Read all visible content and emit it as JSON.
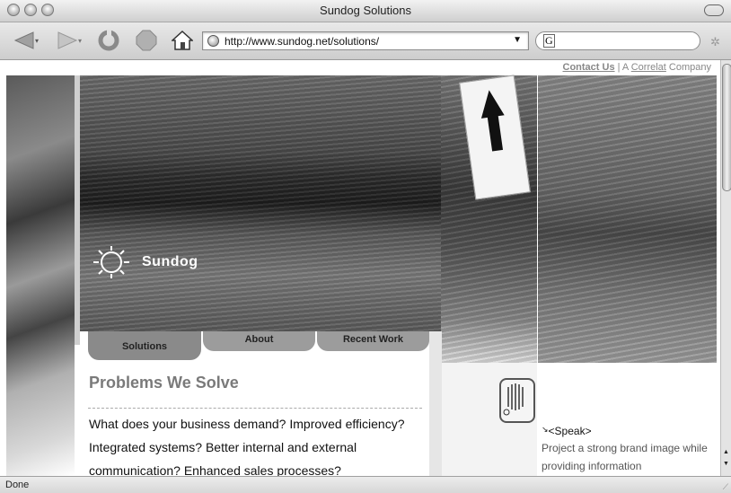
{
  "window": {
    "title": "Sundog Solutions"
  },
  "toolbar": {
    "back_icon": "back-arrow-icon",
    "forward_icon": "forward-arrow-icon",
    "reload_icon": "reload-icon",
    "stop_icon": "stop-icon",
    "home_icon": "home-icon",
    "url": "http://www.sundog.net/solutions/",
    "search_engine_glyph": "G",
    "spinner_icon": "activity-spinner-icon"
  },
  "page": {
    "topline": {
      "contact_label": "Contact Us",
      "separator": "| A",
      "correlat_label": "Correlat",
      "company_label": "Company"
    },
    "logo": {
      "text": "Sundog"
    },
    "tabs": [
      {
        "label": "Solutions"
      },
      {
        "label": "About"
      },
      {
        "label": "Recent Work"
      }
    ],
    "heading": "Problems We Solve",
    "paragraph": "What does your business demand? Improved efficiency? Integrated systems? Better internal and external communication? Enhanced sales processes?",
    "speak": {
      "title": "<Speak>",
      "body": "Project a strong brand image while providing information"
    }
  },
  "status": {
    "text": "Done"
  },
  "colors": {
    "heading": "#7a7a7a",
    "tab_active": "#8a8a8a",
    "tab_inactive": "#9c9c9c"
  }
}
